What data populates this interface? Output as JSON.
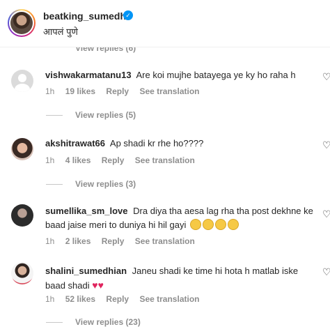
{
  "header": {
    "username": "beatking_sumedh",
    "location": "आपलं पुणे"
  },
  "partial_view_replies": "View replies (6)",
  "comments": [
    {
      "username": "vishwakarmatanu13",
      "text": "Are koi mujhe batayega ye ky ho raha h",
      "time": "1h",
      "likes": "19 likes",
      "reply": "Reply",
      "see_translation": "See translation",
      "view_replies": "View replies (5)"
    },
    {
      "username": "akshitrawat66",
      "text": "Ap shadi kr rhe ho????",
      "time": "1h",
      "likes": "4 likes",
      "reply": "Reply",
      "see_translation": "See translation",
      "view_replies": "View replies (3)"
    },
    {
      "username": "sumellika_sm_love",
      "text": "Dra diya tha aesa lag rha tha post dekhne ke baad jaise meri to duniya hi hil gayi",
      "time": "1h",
      "likes": "2 likes",
      "reply": "Reply",
      "see_translation": "See translation"
    },
    {
      "username": "shalini_sumedhian",
      "text": "Janeu shadi ke time hi hota h matlab iske baad shadi",
      "emoji_text": "♥♥",
      "time": "1h",
      "likes": "52 likes",
      "reply": "Reply",
      "see_translation": "See translation",
      "view_replies": "View replies (23)"
    }
  ],
  "icons": {
    "verified": "verified-badge-icon",
    "like": "heart-outline-icon"
  }
}
